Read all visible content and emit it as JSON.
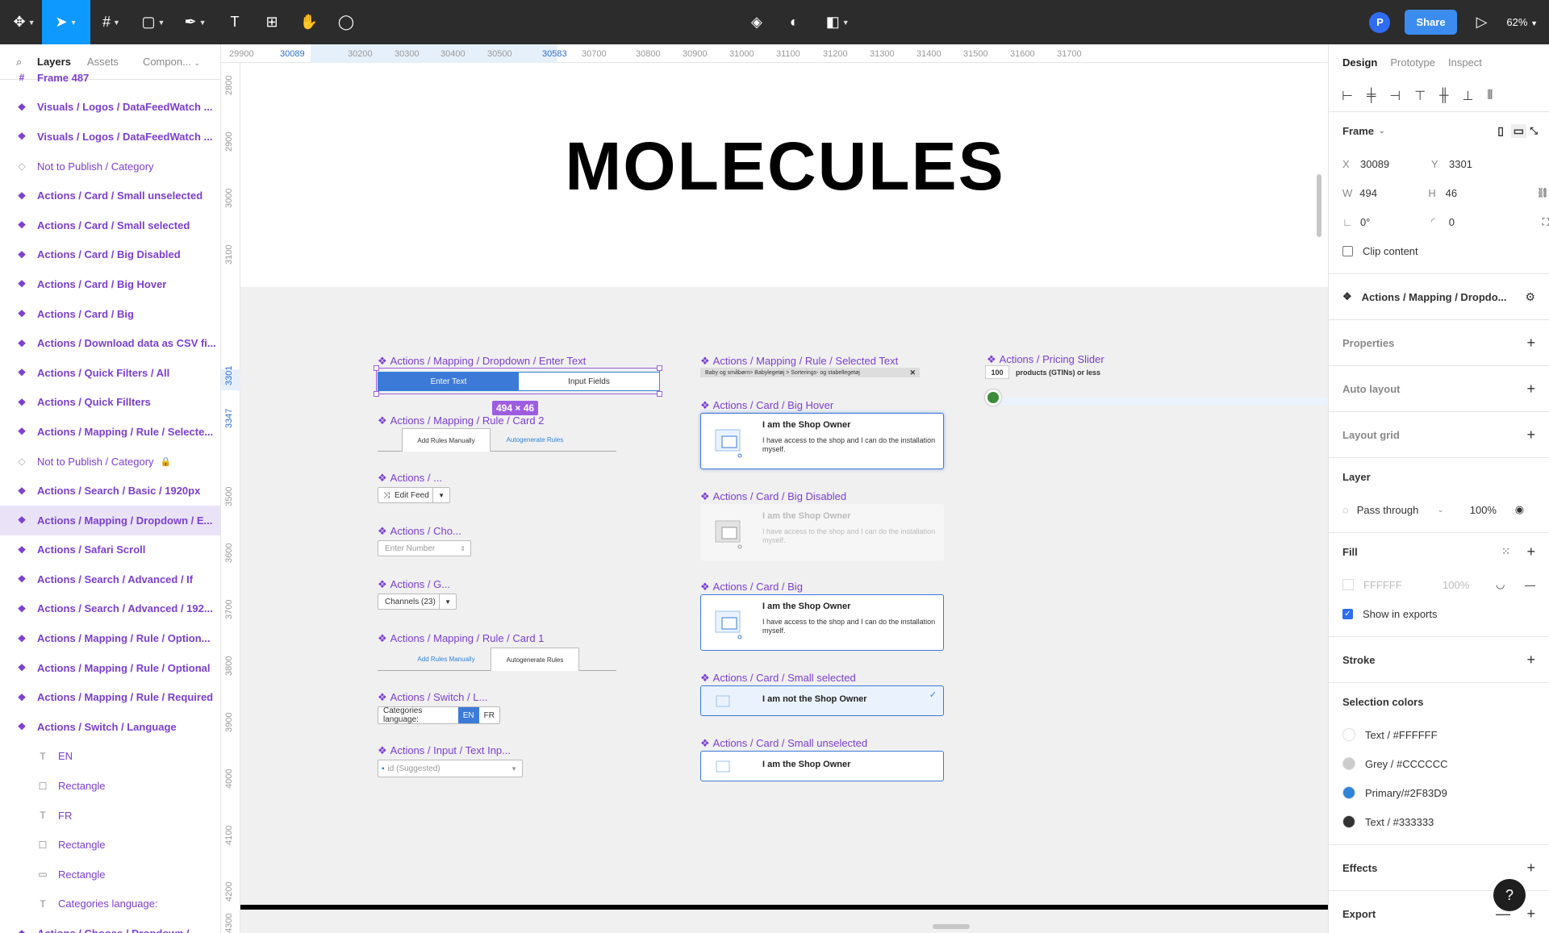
{
  "toolbar": {
    "zoom": "62%",
    "share_label": "Share",
    "avatar_initial": "P"
  },
  "left_panel": {
    "tabs": [
      "Layers",
      "Assets",
      "Compon..."
    ],
    "layers": [
      {
        "label": "Frame 487",
        "kind": "frame"
      },
      {
        "label": "Visuals / Logos / DataFeedWatch ...",
        "kind": "comp"
      },
      {
        "label": "Visuals / Logos / DataFeedWatch ...",
        "kind": "comp"
      },
      {
        "label": "Not to Publish / Category",
        "kind": "grey"
      },
      {
        "label": "Actions / Card / Small unselected",
        "kind": "comp"
      },
      {
        "label": "Actions / Card / Small selected",
        "kind": "comp"
      },
      {
        "label": "Actions / Card / Big Disabled",
        "kind": "comp"
      },
      {
        "label": "Actions / Card / Big Hover",
        "kind": "comp"
      },
      {
        "label": "Actions / Card / Big",
        "kind": "comp"
      },
      {
        "label": "Actions / Download data as CSV fi...",
        "kind": "comp"
      },
      {
        "label": "Actions / Quick Filters / All",
        "kind": "comp"
      },
      {
        "label": "Actions / Quick Fillters",
        "kind": "comp"
      },
      {
        "label": "Actions / Mapping / Rule / Selecte...",
        "kind": "comp"
      },
      {
        "label": "Not to Publish / Category",
        "kind": "grey"
      },
      {
        "label": "Actions / Search / Basic / 1920px",
        "kind": "comp"
      },
      {
        "label": "Actions / Mapping / Dropdown / E...",
        "kind": "comp"
      },
      {
        "label": "Actions / Safari Scroll",
        "kind": "comp"
      },
      {
        "label": "Actions / Search / Advanced / If",
        "kind": "comp"
      },
      {
        "label": "Actions / Search / Advanced / 192...",
        "kind": "comp"
      },
      {
        "label": "Actions / Mapping / Rule / Option...",
        "kind": "comp"
      },
      {
        "label": "Actions / Mapping / Rule / Optional",
        "kind": "comp"
      },
      {
        "label": "Actions / Mapping / Rule / Required",
        "kind": "comp"
      },
      {
        "label": "Actions / Switch / Language",
        "kind": "comp"
      },
      {
        "label": "EN",
        "kind": "text"
      },
      {
        "label": "Rectangle",
        "kind": "rect"
      },
      {
        "label": "FR",
        "kind": "text"
      },
      {
        "label": "Rectangle",
        "kind": "rect"
      },
      {
        "label": "Rectangle",
        "kind": "line"
      },
      {
        "label": "Categories language:",
        "kind": "text"
      },
      {
        "label": "Actions / Choose / Dropdown / ...",
        "kind": "comp"
      }
    ]
  },
  "ruler_top": {
    "labels": [
      "29900",
      "30089",
      "30200",
      "30300",
      "30400",
      "30500",
      "30583",
      "30700",
      "30800",
      "30900",
      "31000",
      "31100",
      "31200",
      "31300",
      "31400",
      "31500",
      "31600",
      "31700"
    ],
    "highlight_start": "30089",
    "highlight_end": "30583"
  },
  "ruler_left": {
    "labels": [
      "2800",
      "2900",
      "3000",
      "3100",
      "3301",
      "3347",
      "3500",
      "3600",
      "3700",
      "3800",
      "3900",
      "4000",
      "4100",
      "4200",
      "4300"
    ]
  },
  "canvas": {
    "title": "MOLECULES",
    "dimension_badge": "494 × 46",
    "labels": {
      "dropdown_enter_text": "Actions / Mapping / Dropdown / Enter Text",
      "rule_card2": "Actions / Mapping / Rule / Card 2",
      "actions_short": "Actions / ...",
      "choose": "Actions / Cho...",
      "group": "Actions / G...",
      "rule_card1": "Actions / Mapping / Rule / Card 1",
      "switch": "Actions / Switch / L...",
      "input": "Actions / Input / Text Inp...",
      "selected_text": "Actions / Mapping / Rule / Selected Text",
      "big_hover": "Actions / Card / Big Hover",
      "big_disabled": "Actions / Card / Big Disabled",
      "big": "Actions / Card / Big",
      "small_selected": "Actions / Card / Small selected",
      "small_unselected": "Actions / Card / Small unselected",
      "pricing_slider": "Actions / Pricing Slider"
    },
    "dropdown": {
      "left": "Enter Text",
      "right": "Input Fields"
    },
    "rule_tabs": {
      "manual": "Add Rules Manually",
      "auto": "Autogenerate Rules"
    },
    "edit_feed": "Edit Feed",
    "enter_number": "Enter Number",
    "channels": "Channels (23)",
    "lang_label": "Categories language:",
    "lang_en": "EN",
    "lang_fr": "FR",
    "id_suggested": "id (Suggested)",
    "chip_text": "Baby og småbørn> Babylegetøj > Sorterings- og stabellegetøj",
    "card_owner_title": "I am the Shop Owner",
    "card_owner_desc": "I have access to the shop and I can do the installation myself.",
    "card_not_owner": "I am not the Shop Owner",
    "slider_value": "100",
    "slider_text": "products (GTINs) or less"
  },
  "right_panel": {
    "tabs": [
      "Design",
      "Prototype",
      "Inspect"
    ],
    "frame_label": "Frame",
    "x": "30089",
    "y": "3301",
    "w": "494",
    "h": "46",
    "rotation": "0°",
    "radius": "0",
    "clip_content": "Clip content",
    "component_name": "Actions / Mapping / Dropdo...",
    "properties": "Properties",
    "auto_layout": "Auto layout",
    "layout_grid": "Layout grid",
    "layer": "Layer",
    "blend": "Pass through",
    "opacity": "100%",
    "fill": "Fill",
    "fill_hex": "FFFFFF",
    "fill_opacity": "100%",
    "show_in_exports": "Show in exports",
    "stroke": "Stroke",
    "selection_colors": "Selection colors",
    "colors": [
      {
        "label": "Text / #FFFFFF",
        "hex": "#FFFFFF"
      },
      {
        "label": "Grey / #CCCCCC",
        "hex": "#CCCCCC"
      },
      {
        "label": "Primary/#2F83D9",
        "hex": "#2F83D9"
      },
      {
        "label": "Text / #333333",
        "hex": "#333333"
      }
    ],
    "effects": "Effects",
    "export": "Export"
  }
}
